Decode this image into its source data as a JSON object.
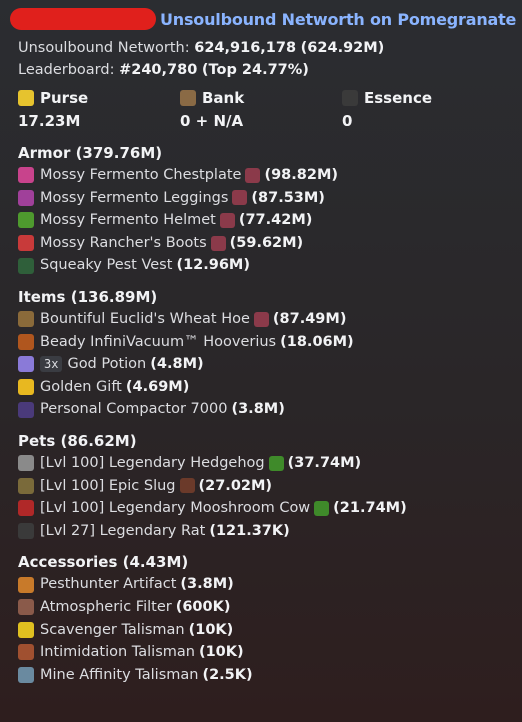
{
  "title": "Unsoulbound Networth on Pomegranate",
  "summary": {
    "networth_label": "Unsoulbound Networth:",
    "networth_value": "624,916,178",
    "networth_short": "(624.92M)",
    "leaderboard_label": "Leaderboard:",
    "leaderboard_rank": "#240,780",
    "leaderboard_top": "(Top 24.77%)"
  },
  "stats": [
    {
      "name": "Purse",
      "value": "17.23M",
      "icon": "gold-ingot-icon",
      "color": "#e6c32e"
    },
    {
      "name": "Bank",
      "value": "0 + N/A",
      "icon": "bank-chest-icon",
      "color": "#8a6a45"
    },
    {
      "name": "Essence",
      "value": "0",
      "icon": "wither-skull-icon",
      "color": "#3a3a3a"
    }
  ],
  "sections": [
    {
      "title": "Armor",
      "total": "(379.76M)",
      "items": [
        {
          "name": "Mossy Fermento Chestplate",
          "value": "(98.82M)",
          "icon": "chestplate-icon",
          "color": "#c8438c",
          "extra_color": "#8b3a4a",
          "qty": ""
        },
        {
          "name": "Mossy Fermento Leggings",
          "value": "(87.53M)",
          "icon": "leggings-icon",
          "color": "#a0409a",
          "extra_color": "#8b3a4a",
          "qty": ""
        },
        {
          "name": "Mossy Fermento Helmet",
          "value": "(77.42M)",
          "icon": "helmet-icon",
          "color": "#4e9a2e",
          "extra_color": "#8b3a4a",
          "qty": ""
        },
        {
          "name": "Mossy Rancher's Boots",
          "value": "(59.62M)",
          "icon": "boots-icon",
          "color": "#c83a3a",
          "extra_color": "#8b3a4a",
          "qty": ""
        },
        {
          "name": "Squeaky Pest Vest",
          "value": "(12.96M)",
          "icon": "vest-icon",
          "color": "#2f5f3a",
          "extra_color": "",
          "qty": ""
        }
      ]
    },
    {
      "title": "Items",
      "total": "(136.89M)",
      "items": [
        {
          "name": "Bountiful Euclid's Wheat Hoe",
          "value": "(87.49M)",
          "icon": "hoe-icon",
          "color": "#8a6a3a",
          "extra_color": "#8b3a4a",
          "qty": ""
        },
        {
          "name": "Beady InfiniVacuum™ Hooverius",
          "value": "(18.06M)",
          "icon": "vacuum-icon",
          "color": "#b0561e",
          "extra_color": "",
          "qty": ""
        },
        {
          "name": "God Potion",
          "value": "(4.8M)",
          "icon": "god-potion-icon",
          "color": "#8a7ad8",
          "extra_color": "",
          "qty": "3x"
        },
        {
          "name": "Golden Gift",
          "value": "(4.69M)",
          "icon": "golden-gift-icon",
          "color": "#e8b820",
          "extra_color": "",
          "qty": ""
        },
        {
          "name": "Personal Compactor 7000",
          "value": "(3.8M)",
          "icon": "compactor-icon",
          "color": "#4a3a7a",
          "extra_color": "",
          "qty": ""
        }
      ]
    },
    {
      "title": "Pets",
      "total": "(86.62M)",
      "items": [
        {
          "name": "[Lvl 100] Legendary Hedgehog",
          "value": "(37.74M)",
          "icon": "hedgehog-icon",
          "color": "#8a8a8a",
          "extra_color": "#3f8a2a",
          "qty": ""
        },
        {
          "name": "[Lvl 100] Epic Slug",
          "value": "(27.02M)",
          "icon": "slug-icon",
          "color": "#7a6a3a",
          "extra_color": "#6b3a2a",
          "qty": ""
        },
        {
          "name": "[Lvl 100] Legendary Mooshroom Cow",
          "value": "(21.74M)",
          "icon": "mooshroom-icon",
          "color": "#b02828",
          "extra_color": "#3f8a2a",
          "qty": ""
        },
        {
          "name": "[Lvl 27] Legendary Rat",
          "value": "(121.37K)",
          "icon": "rat-icon",
          "color": "#3a3a3a",
          "extra_color": "",
          "qty": ""
        }
      ]
    },
    {
      "title": "Accessories",
      "total": "(4.43M)",
      "items": [
        {
          "name": "Pesthunter Artifact",
          "value": "(3.8M)",
          "icon": "pesthunter-icon",
          "color": "#c87a2a",
          "extra_color": "",
          "qty": ""
        },
        {
          "name": "Atmospheric Filter",
          "value": "(600K)",
          "icon": "filter-icon",
          "color": "#8a5a4a",
          "extra_color": "",
          "qty": ""
        },
        {
          "name": "Scavenger Talisman",
          "value": "(10K)",
          "icon": "scavenger-icon",
          "color": "#e0c020",
          "extra_color": "",
          "qty": ""
        },
        {
          "name": "Intimidation Talisman",
          "value": "(10K)",
          "icon": "intimidation-icon",
          "color": "#a05030",
          "extra_color": "",
          "qty": ""
        },
        {
          "name": "Mine Affinity Talisman",
          "value": "(2.5K)",
          "icon": "mine-affinity-icon",
          "color": "#6a8aa0",
          "extra_color": "",
          "qty": ""
        }
      ]
    }
  ]
}
